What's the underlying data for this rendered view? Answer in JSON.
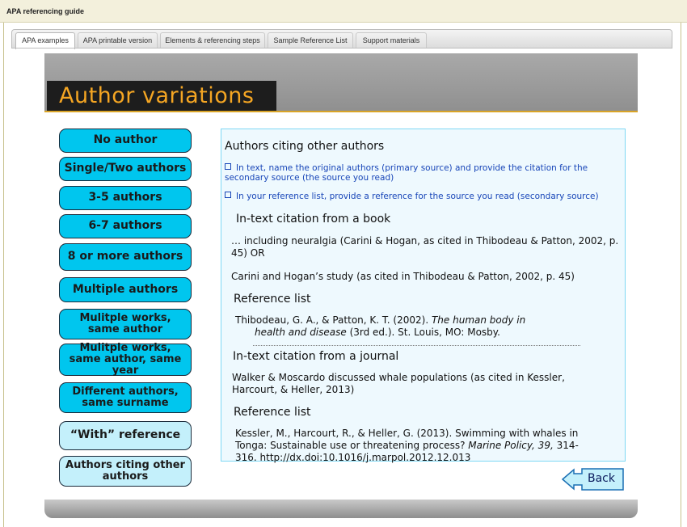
{
  "window": {
    "title": "APA referencing guide"
  },
  "tabs": [
    {
      "label": "APA examples"
    },
    {
      "label": "APA printable version"
    },
    {
      "label": "Elements & referencing steps"
    },
    {
      "label": "Sample Reference List"
    },
    {
      "label": "Support materials"
    }
  ],
  "slide": {
    "heading": "Author variations"
  },
  "nav": [
    {
      "label": "No author"
    },
    {
      "label": "Single/Two authors"
    },
    {
      "label": "3-5 authors"
    },
    {
      "label": "6-7 authors"
    },
    {
      "label": "8 or more authors"
    },
    {
      "label": "Multiple authors"
    },
    {
      "label": "Mulitple works, same author"
    },
    {
      "label": "Mulitple works, same author, same year"
    },
    {
      "label": "Different authors, same surname"
    },
    {
      "label": "“With” reference"
    },
    {
      "label": "Authors citing other authors"
    }
  ],
  "panel": {
    "title": "Authors citing other authors",
    "bullets": [
      "In text, name the original authors (primary source) and provide the citation for the secondary source (the source you read)",
      "In your reference list, provide a reference for the source you read (secondary source)"
    ],
    "book_heading": "In-text citation from a book",
    "book_example_1": "… including neuralgia (Carini & Hogan, as cited in Thibodeau & Patton, 2002, p. 45)   OR",
    "book_example_2": "Carini and Hogan’s study (as cited in Thibodeau & Patton, 2002, p. 45)",
    "ref_heading_1": "Reference list",
    "ref1_a": "Thibodeau, G. A., & Patton, K. T. (2002). ",
    "ref1_title_a": "The human body in",
    "ref1_title_b": "health and disease",
    "ref1_b": " (3rd ed.). St. Louis, MO: Mosby.",
    "journal_heading": "In-text citation from a journal",
    "journal_example": "Walker & Moscardo discussed whale populations (as cited in Kessler, Harcourt, & Heller, 2013)",
    "ref_heading_2": "Reference list",
    "ref2_a": "Kessler, M., Harcourt, R., & Heller, G. (2013). Swimming with whales in Tonga: Sustainable use or threatening process? ",
    "ref2_journal": "Marine Policy, 39,",
    "ref2_b": " 314-316. http://dx.doi:10.1016/j.marpol.2012.12.013"
  },
  "back_button": {
    "label": "Back"
  },
  "colors": {
    "nav_button": "#00c6ee",
    "nav_button_light": "#c4f0fb",
    "heading": "#f5a623",
    "link": "#1745b8"
  }
}
